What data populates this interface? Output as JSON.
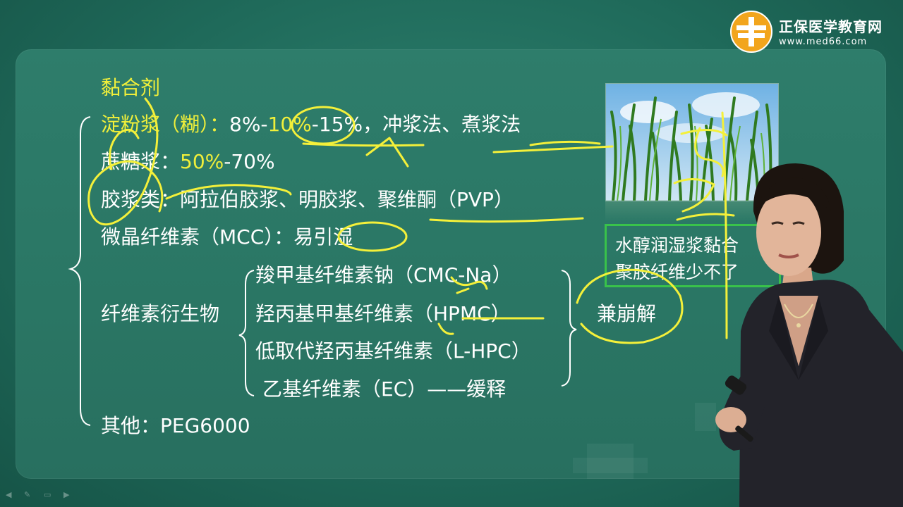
{
  "brand": {
    "name": "正保医学教育网",
    "url": "www.med66.com",
    "logo_icon": "cross-logo-icon",
    "logo_color": "#f2a51d"
  },
  "slide": {
    "heading": "黏合剂",
    "rows": {
      "starch": {
        "label": "淀粉浆（糊）：",
        "pct_a": "8%-",
        "pct_b": "10%",
        "pct_c": "-15%",
        "methods": "，冲浆法、煮浆法"
      },
      "sucrose": {
        "label": "蔗糖浆：",
        "pct_a": "50%",
        "pct_b": "-70%"
      },
      "gum": {
        "label": "胶浆类：",
        "items": "阿拉伯胶浆、明胶浆、聚维酮（PVP）"
      },
      "mcc": {
        "label": "微晶纤维素（MCC）：易引湿"
      },
      "cellulose": {
        "label": "纤维素衍生物",
        "items": [
          "羧甲基纤维素钠（CMC-Na）",
          "羟丙基甲基纤维素（HPMC）",
          "低取代羟丙基纤维素（L-HPC）",
          "乙基纤维素（EC）——缓释"
        ],
        "disintegrant": "兼崩解"
      },
      "other": {
        "label": "其他：PEG6000"
      }
    },
    "note": {
      "line1": "水醇润湿浆黏合",
      "line2": "聚胶纤维少不了",
      "border_color": "#39c24a"
    }
  },
  "colors": {
    "board": "#2a7664",
    "highlight_text": "#f0ef3a",
    "ink": "#f4f03a"
  },
  "player_controls": [
    "prev-icon",
    "pen-icon",
    "screen-icon",
    "next-icon"
  ]
}
